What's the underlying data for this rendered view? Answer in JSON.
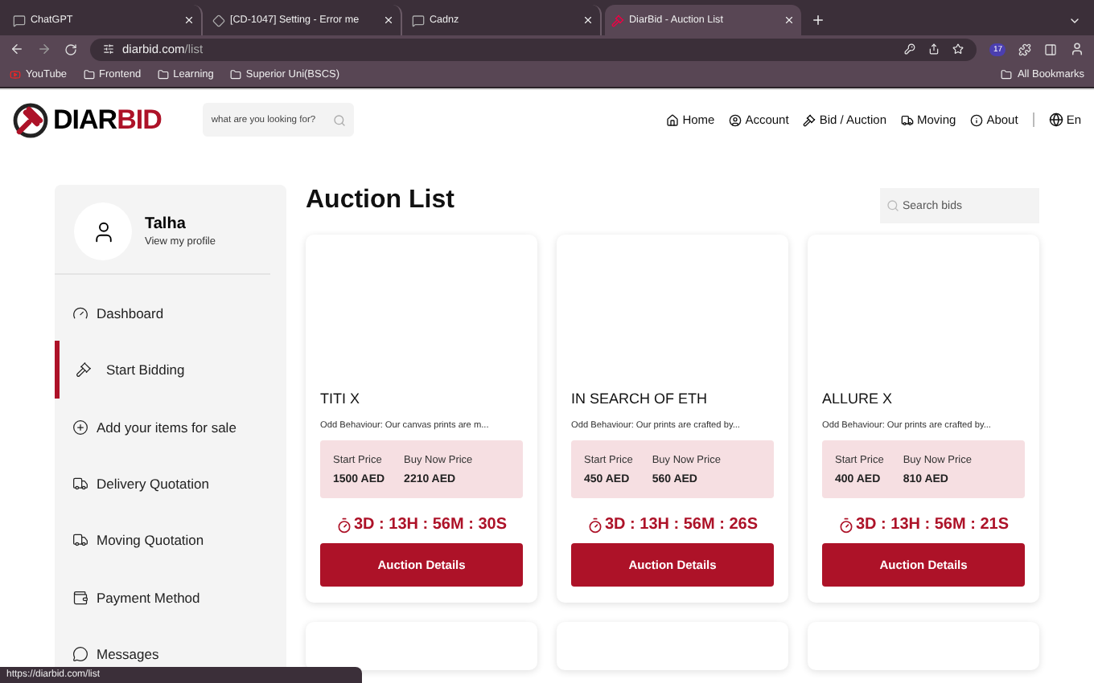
{
  "browser": {
    "tabs": [
      {
        "title": "ChatGPT",
        "selected": false
      },
      {
        "title": "[CD-1047] Setting - Error me",
        "selected": false
      },
      {
        "title": "Cadnz",
        "selected": false
      },
      {
        "title": "DiarBid - Auction List",
        "selected": true
      }
    ],
    "url": {
      "host": "diarbid.com",
      "path": "/list"
    },
    "bookmarks": [
      "YouTube",
      "Frontend",
      "Learning",
      "Superior Uni(BSCS)"
    ],
    "all_bookmarks": "All Bookmarks",
    "extension_badge": "17"
  },
  "header": {
    "logo": {
      "first": "DIAR",
      "second": "BID"
    },
    "search": {
      "placeholder": "what are you looking for?"
    },
    "nav": [
      {
        "kind": "home",
        "label": "Home"
      },
      {
        "kind": "account",
        "label": "Account"
      },
      {
        "kind": "bid",
        "label": "Bid / Auction"
      },
      {
        "kind": "moving",
        "label": "Moving"
      },
      {
        "kind": "about",
        "label": "About"
      }
    ],
    "language": "En"
  },
  "sidebar": {
    "profile": {
      "name": "Talha",
      "link": "View my profile"
    },
    "items": [
      {
        "kind": "dashboard",
        "label": "Dashboard",
        "selected": false
      },
      {
        "kind": "bidding",
        "label": "Start Bidding",
        "selected": true
      },
      {
        "kind": "add",
        "label": "Add your items for sale",
        "selected": false
      },
      {
        "kind": "delivery",
        "label": "Delivery Quotation",
        "selected": false
      },
      {
        "kind": "moving",
        "label": "Moving Quotation",
        "selected": false
      },
      {
        "kind": "payment",
        "label": "Payment Method",
        "selected": false
      },
      {
        "kind": "messages",
        "label": "Messages",
        "selected": false
      }
    ]
  },
  "main": {
    "title": "Auction List",
    "search": {
      "placeholder": "Search bids"
    },
    "cards": [
      {
        "title": "TITI X",
        "description": "Odd Behaviour: Our canvas prints are m...",
        "start_label": "Start Price",
        "buy_now_label": "Buy Now Price",
        "start_price": "1500 AED",
        "buy_now_price": "2210 AED",
        "countdown": "3D : 13H : 56M : 30S",
        "button": "Auction Details"
      },
      {
        "title": "IN SEARCH OF ETH",
        "description": "Odd Behaviour: Our prints are crafted by...",
        "start_label": "Start Price",
        "buy_now_label": "Buy Now Price",
        "start_price": "450 AED",
        "buy_now_price": "560 AED",
        "countdown": "3D : 13H : 56M : 26S",
        "button": "Auction Details"
      },
      {
        "title": "ALLURE X",
        "description": "Odd Behaviour: Our prints are crafted by...",
        "start_label": "Start Price",
        "buy_now_label": "Buy Now Price",
        "start_price": "400 AED",
        "buy_now_price": "810 AED",
        "countdown": "3D : 13H : 56M : 21S",
        "button": "Auction Details"
      }
    ]
  },
  "status_bar": "https://diarbid.com/list"
}
